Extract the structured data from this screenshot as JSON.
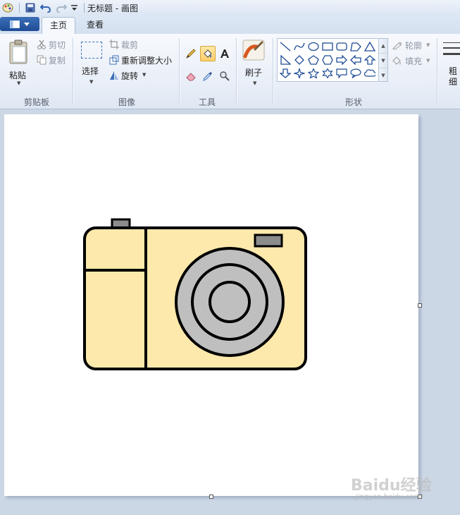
{
  "window": {
    "title": "无标题 - 画图"
  },
  "tabs": {
    "home": "主页",
    "view": "查看"
  },
  "clipboard": {
    "paste": "粘贴",
    "cut": "剪切",
    "copy": "复制",
    "group_label": "剪贴板"
  },
  "image": {
    "select": "选择",
    "crop": "裁剪",
    "resize": "重新调整大小",
    "rotate": "旋转",
    "group_label": "图像"
  },
  "tools": {
    "group_label": "工具",
    "active_tool": "fill-icon"
  },
  "brushes": {
    "label": "刷子"
  },
  "shapes": {
    "group_label": "形状",
    "outline": "轮廓",
    "fill": "填充",
    "size_label": "粗细"
  },
  "colors": {
    "camera_body": "#fde9ac",
    "camera_gray": "#bfbfbf",
    "camera_flash": "#8c8c8c",
    "outline": "#000000",
    "accent_blue": "#1e4c95"
  },
  "watermark": {
    "main": "Baidu经验",
    "sub": "jingyan.baidu.com"
  }
}
